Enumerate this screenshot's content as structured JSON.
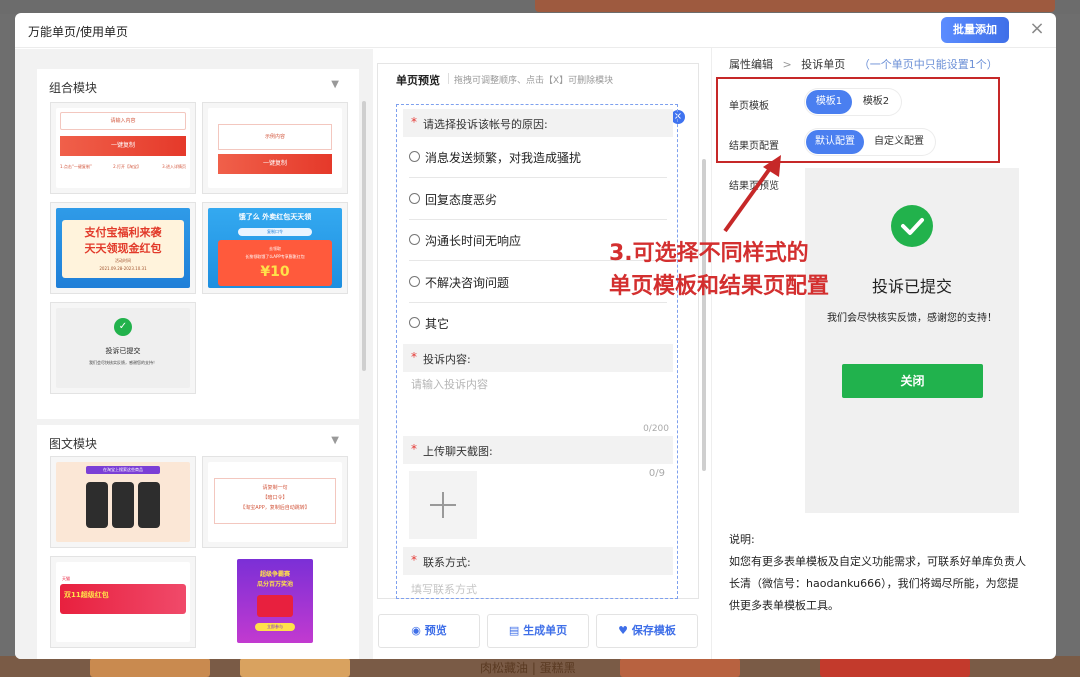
{
  "modal": {
    "title": "万能单页/使用单页",
    "batch_add_label": "批量添加",
    "close_glyph": "×"
  },
  "backdrop": {
    "bottom_text": "肉松藏油 | 蛋糕黑"
  },
  "left": {
    "group_module": {
      "title": "组合模块",
      "thumbs": [
        {
          "texts": [
            "请输入内容",
            "一键复制",
            "1.点击“一键复制”",
            "2.打开【淘宝】",
            "3.进入详情页"
          ]
        },
        {
          "texts": [
            "示例内容",
            "一键复制"
          ]
        },
        {
          "texts": [
            "支付宝福利来袭",
            "天天领现金红包",
            "活动时间",
            "2021.09.28-2023.10.31"
          ]
        },
        {
          "texts": [
            "饿了么  外卖红包天天领",
            "复制口令",
            "去领取",
            "长按领取饿了么APP专享膨胀红包",
            "¥10"
          ]
        },
        {
          "texts": [
            "投诉已提交",
            "我们会尽快核实反馈，感谢您的支持！"
          ]
        }
      ]
    },
    "text_image_module": {
      "title": "图文模块",
      "thumbs": [
        {
          "texts": [
            "在淘宝上搜索这些商品"
          ]
        },
        {
          "texts": [
            "请复制一句",
            "【暗口令】",
            "【淘宝APP，复制后自动跳转】"
          ]
        },
        {
          "texts": [
            "双11超级红包",
            "天猫"
          ]
        },
        {
          "texts": [
            "超级争霸赛",
            "瓜分百万奖池",
            "立即参与"
          ]
        }
      ]
    }
  },
  "middle": {
    "title": "单页预览",
    "hint": "拖拽可调整顺序、点击【X】可删除模块",
    "remove_glyph": "×",
    "q1_label": "请选择投诉该帐号的原因:",
    "options": [
      "消息发送频繁，对我造成骚扰",
      "回复态度恶劣",
      "沟通长时间无响应",
      "不解决咨询问题",
      "其它"
    ],
    "content_label": "投诉内容:",
    "content_placeholder": "请输入投诉内容",
    "content_counter": "0/200",
    "upload_label": "上传聊天截图:",
    "upload_counter": "0/9",
    "contact_label": "联系方式:",
    "contact_placeholder": "填写联系方式",
    "actions": {
      "preview": "预览",
      "generate": "生成单页",
      "save_template": "保存模板"
    }
  },
  "right": {
    "breadcrumb_root": "属性编辑",
    "breadcrumb_sep": ">",
    "breadcrumb_current": "投诉单页",
    "breadcrumb_note": "（一个单页中只能设置1个）",
    "template_label": "单页模板",
    "template_options": [
      "模板1",
      "模板2"
    ],
    "result_label": "结果页配置",
    "result_options": [
      "默认配置",
      "自定义配置"
    ],
    "preview_label": "结果页预览",
    "result_preview": {
      "title": "投诉已提交",
      "subtitle": "我们会尽快核实反馈，感谢您的支持！",
      "button": "关闭"
    },
    "note_title": "说明:",
    "note_body": "如您有更多表单模板及自定义功能需求，可联系好单库负责人长清（微信号：haodanku666），我们将竭尽所能，为您提供更多表单模板工具。"
  },
  "annotation": {
    "line1": "3.可选择不同样式的",
    "line2": "单页模板和结果页配置"
  },
  "colors": {
    "accent": "#4a7ff0",
    "success": "#21b24d",
    "annotation": "#d32f2f"
  }
}
